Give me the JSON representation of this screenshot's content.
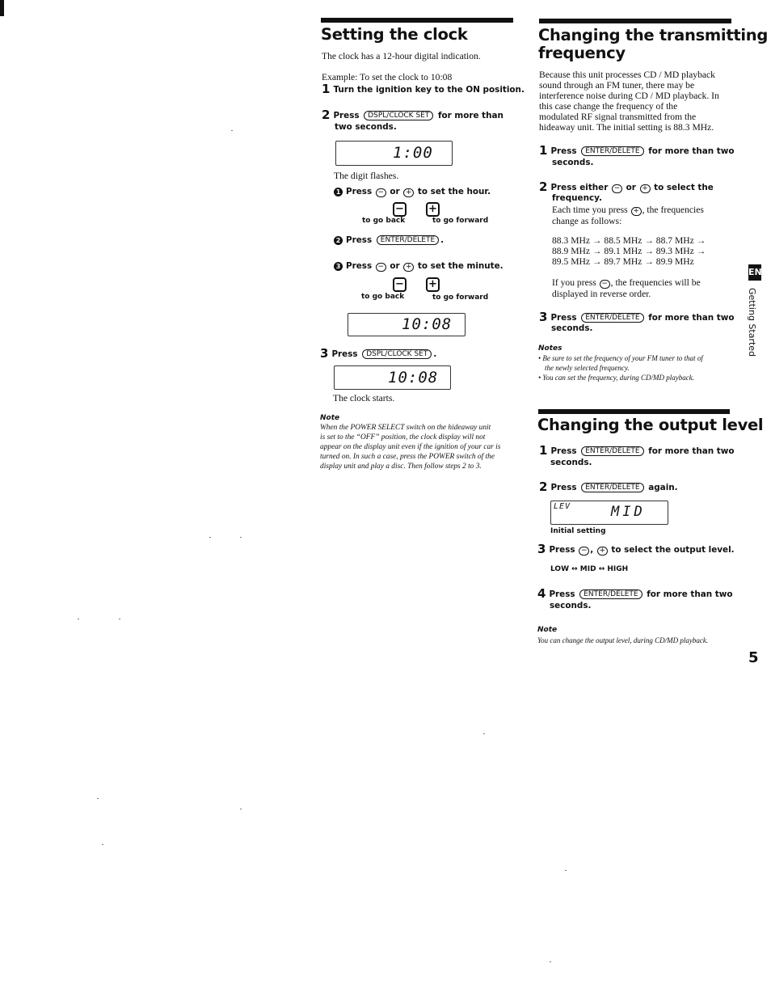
{
  "page": {
    "number": "5",
    "side_tab": "EN",
    "side_label": "Getting Started"
  },
  "clock": {
    "title": "Setting the clock",
    "intro": "The clock has a 12-hour digital indication.",
    "example": "Example: To set the clock to 10:08",
    "step1": {
      "num": "1",
      "text": "Turn the ignition key to the ON position."
    },
    "step2": {
      "num": "2",
      "pre": "Press",
      "key": "DSPL/CLOCK SET",
      "post": "for more than",
      "post2": "two seconds."
    },
    "display1": "1:00",
    "digit_flashes": "The digit flashes.",
    "sub1": {
      "num": "1",
      "pre": "Press",
      "minus": "−",
      "or": "or",
      "plus": "+",
      "post": "to set the hour."
    },
    "back_label": "to go back",
    "forward_label": "to go forward",
    "sub2": {
      "num": "2",
      "pre": "Press",
      "key": "ENTER/DELETE",
      "post": "."
    },
    "sub3": {
      "num": "3",
      "pre": "Press",
      "minus": "−",
      "or": "or",
      "plus": "+",
      "post": "to set the minute."
    },
    "display2": "10:08",
    "step3": {
      "num": "3",
      "pre": "Press",
      "key": "DSPL/CLOCK SET",
      "post": "."
    },
    "display3": "10:08",
    "clock_starts": "The clock starts.",
    "note_title": "Note",
    "note_lines": [
      "When the POWER SELECT switch on the hideaway unit",
      "is set to the “OFF” position, the clock display will not",
      "appear on the display unit even if the ignition of your car is",
      "turned on. In such a case, press the POWER switch of the",
      "display unit and play a  disc. Then follow steps 2 to 3."
    ]
  },
  "freq": {
    "title_line1": "Changing the transmitting",
    "title_line2": "frequency",
    "intro_lines": [
      "Because this unit processes CD / MD playback",
      "sound through an  FM tuner, there may be",
      "interference noise during CD / MD playback. In",
      "this case change the frequency of the",
      "modulated RF signal transmitted from the",
      "hideaway unit. The initial setting is 88.3 MHz."
    ],
    "step1": {
      "num": "1",
      "pre": "Press",
      "key": "ENTER/DELETE",
      "post": "for more than two",
      "post2": "seconds."
    },
    "step2": {
      "num": "2",
      "pre": "Press either",
      "minus": "−",
      "or": "or",
      "plus": "+",
      "post": "to select the",
      "post2": "frequency."
    },
    "each_time_pre": "Each time you press",
    "each_time_post": ", the frequencies",
    "each_time_line2": "change as follows:",
    "freq_rows": [
      "88.3 MHz → 88.5 MHz → 88.7 MHz →",
      "88.9 MHz → 89.1 MHz → 89.3 MHz →",
      "89.5 MHz → 89.7 MHz → 89.9 MHz"
    ],
    "reverse_pre": "If you press",
    "reverse_post": ", the frequencies  will  be",
    "reverse_line2": "displayed in reverse order.",
    "step3": {
      "num": "3",
      "pre": "Press",
      "key": "ENTER/DELETE",
      "post": "for more than two",
      "post2": "seconds."
    },
    "notes_title": "Notes",
    "notes": [
      "Be sure to set the frequency of your FM tuner to that of",
      "the newly selected frequency.",
      "You can set the frequency, during CD/MD playback."
    ]
  },
  "output": {
    "title": "Changing the output level",
    "step1": {
      "num": "1",
      "pre": "Press",
      "key": "ENTER/DELETE",
      "post": "for more than two",
      "post2": "seconds."
    },
    "step2": {
      "num": "2",
      "pre": "Press",
      "key": "ENTER/DELETE",
      "post": "again."
    },
    "display_label": "LEV",
    "display_value": "MID",
    "initial_setting": "Initial setting",
    "step3": {
      "num": "3",
      "pre": "Press",
      "minus": "−",
      "comma": ",",
      "plus": "+",
      "post": "to select the output level."
    },
    "levels": "LOW ↔ MID ↔ HIGH",
    "step4": {
      "num": "4",
      "pre": "Press",
      "key": "ENTER/DELETE",
      "post": "for more than two",
      "post2": "seconds."
    },
    "note_title": "Note",
    "note_text": "You can change the output level, during CD/MD playback."
  }
}
